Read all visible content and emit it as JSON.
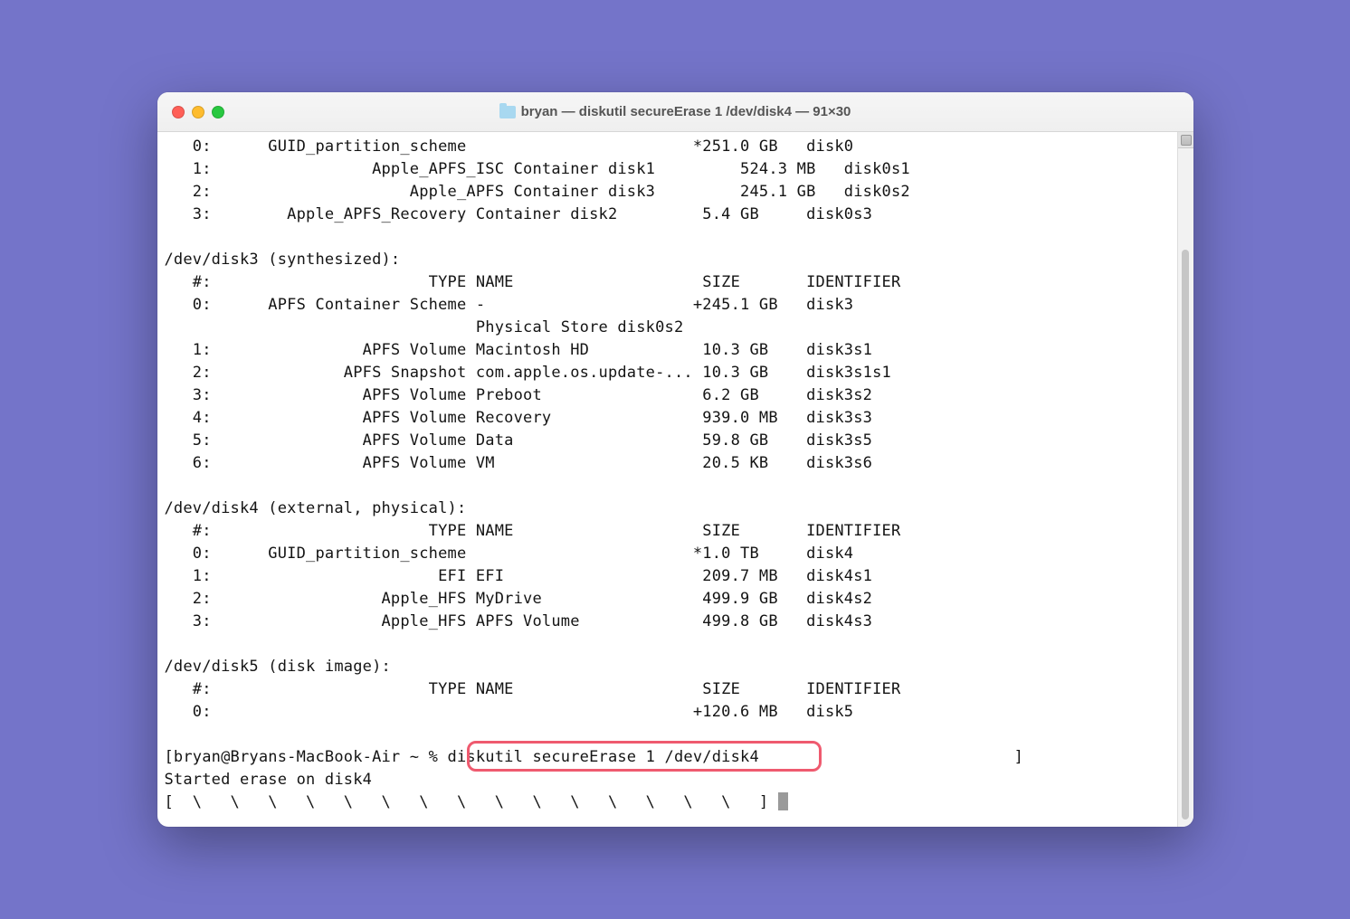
{
  "window": {
    "title": "bryan — diskutil secureErase 1 /dev/disk4 — 91×30"
  },
  "lines": {
    "l0": "   0:      GUID_partition_scheme                        *251.0 GB   disk0",
    "l1": "   1:                 Apple_APFS_ISC Container disk1         524.3 MB   disk0s1",
    "l2": "   2:                     Apple_APFS Container disk3         245.1 GB   disk0s2",
    "l3": "   3:        Apple_APFS_Recovery Container disk2         5.4 GB     disk0s3",
    "l4": "",
    "l5": "/dev/disk3 (synthesized):",
    "l6": "   #:                       TYPE NAME                    SIZE       IDENTIFIER",
    "l7": "   0:      APFS Container Scheme -                      +245.1 GB   disk3",
    "l8": "                                 Physical Store disk0s2",
    "l9": "   1:                APFS Volume Macintosh HD            10.3 GB    disk3s1",
    "l10": "   2:              APFS Snapshot com.apple.os.update-... 10.3 GB    disk3s1s1",
    "l11": "   3:                APFS Volume Preboot                 6.2 GB     disk3s2",
    "l12": "   4:                APFS Volume Recovery                939.0 MB   disk3s3",
    "l13": "   5:                APFS Volume Data                    59.8 GB    disk3s5",
    "l14": "   6:                APFS Volume VM                      20.5 KB    disk3s6",
    "l15": "",
    "l16": "/dev/disk4 (external, physical):",
    "l17": "   #:                       TYPE NAME                    SIZE       IDENTIFIER",
    "l18": "   0:      GUID_partition_scheme                        *1.0 TB     disk4",
    "l19": "   1:                        EFI EFI                     209.7 MB   disk4s1",
    "l20": "   2:                  Apple_HFS MyDrive                 499.9 GB   disk4s2",
    "l21": "   3:                  Apple_HFS APFS Volume             499.8 GB   disk4s3",
    "l22": "",
    "l23": "/dev/disk5 (disk image):",
    "l24": "   #:                       TYPE NAME                    SIZE       IDENTIFIER",
    "l25": "   0:                                                   +120.6 MB   disk5",
    "l26": "",
    "prompt_left": "[bryan@Bryans-MacBook-Air ~ % ",
    "prompt_cmd": "diskutil secureErase 1 /dev/disk4",
    "prompt_right_spacer": "                           ]",
    "l28": "Started erase on disk4",
    "l29": "[  \\   \\   \\   \\   \\   \\   \\   \\   \\   \\   \\   \\   \\   \\   \\   ] "
  }
}
